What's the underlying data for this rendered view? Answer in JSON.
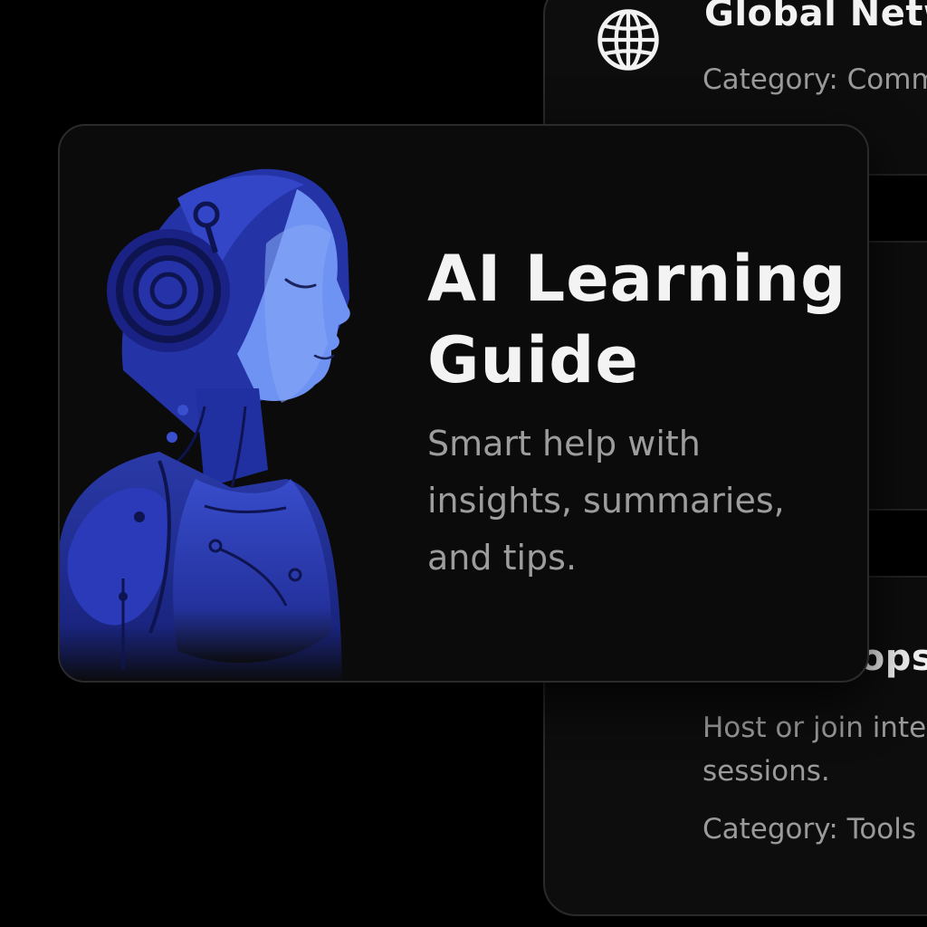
{
  "background_list": {
    "items": [
      {
        "icon": "globe-icon",
        "title": "Global Netw",
        "meta": "Category: Comm"
      },
      {
        "icon": "checkbox-icon",
        "title": "Workshops & S",
        "description": "Host or join inter sessions.",
        "meta": "Category: Tools"
      }
    ]
  },
  "feature_card": {
    "illustration": "ai-robot-head-with-headphones",
    "title": "AI Learning Guide",
    "description": "Smart help with insights, summaries, and tips."
  },
  "colors": {
    "background": "#000000",
    "card": "#0b0b0b",
    "accent_blue": "#3f5fe0",
    "text_primary": "#f3f3f3",
    "text_secondary": "#9d9d9d"
  }
}
